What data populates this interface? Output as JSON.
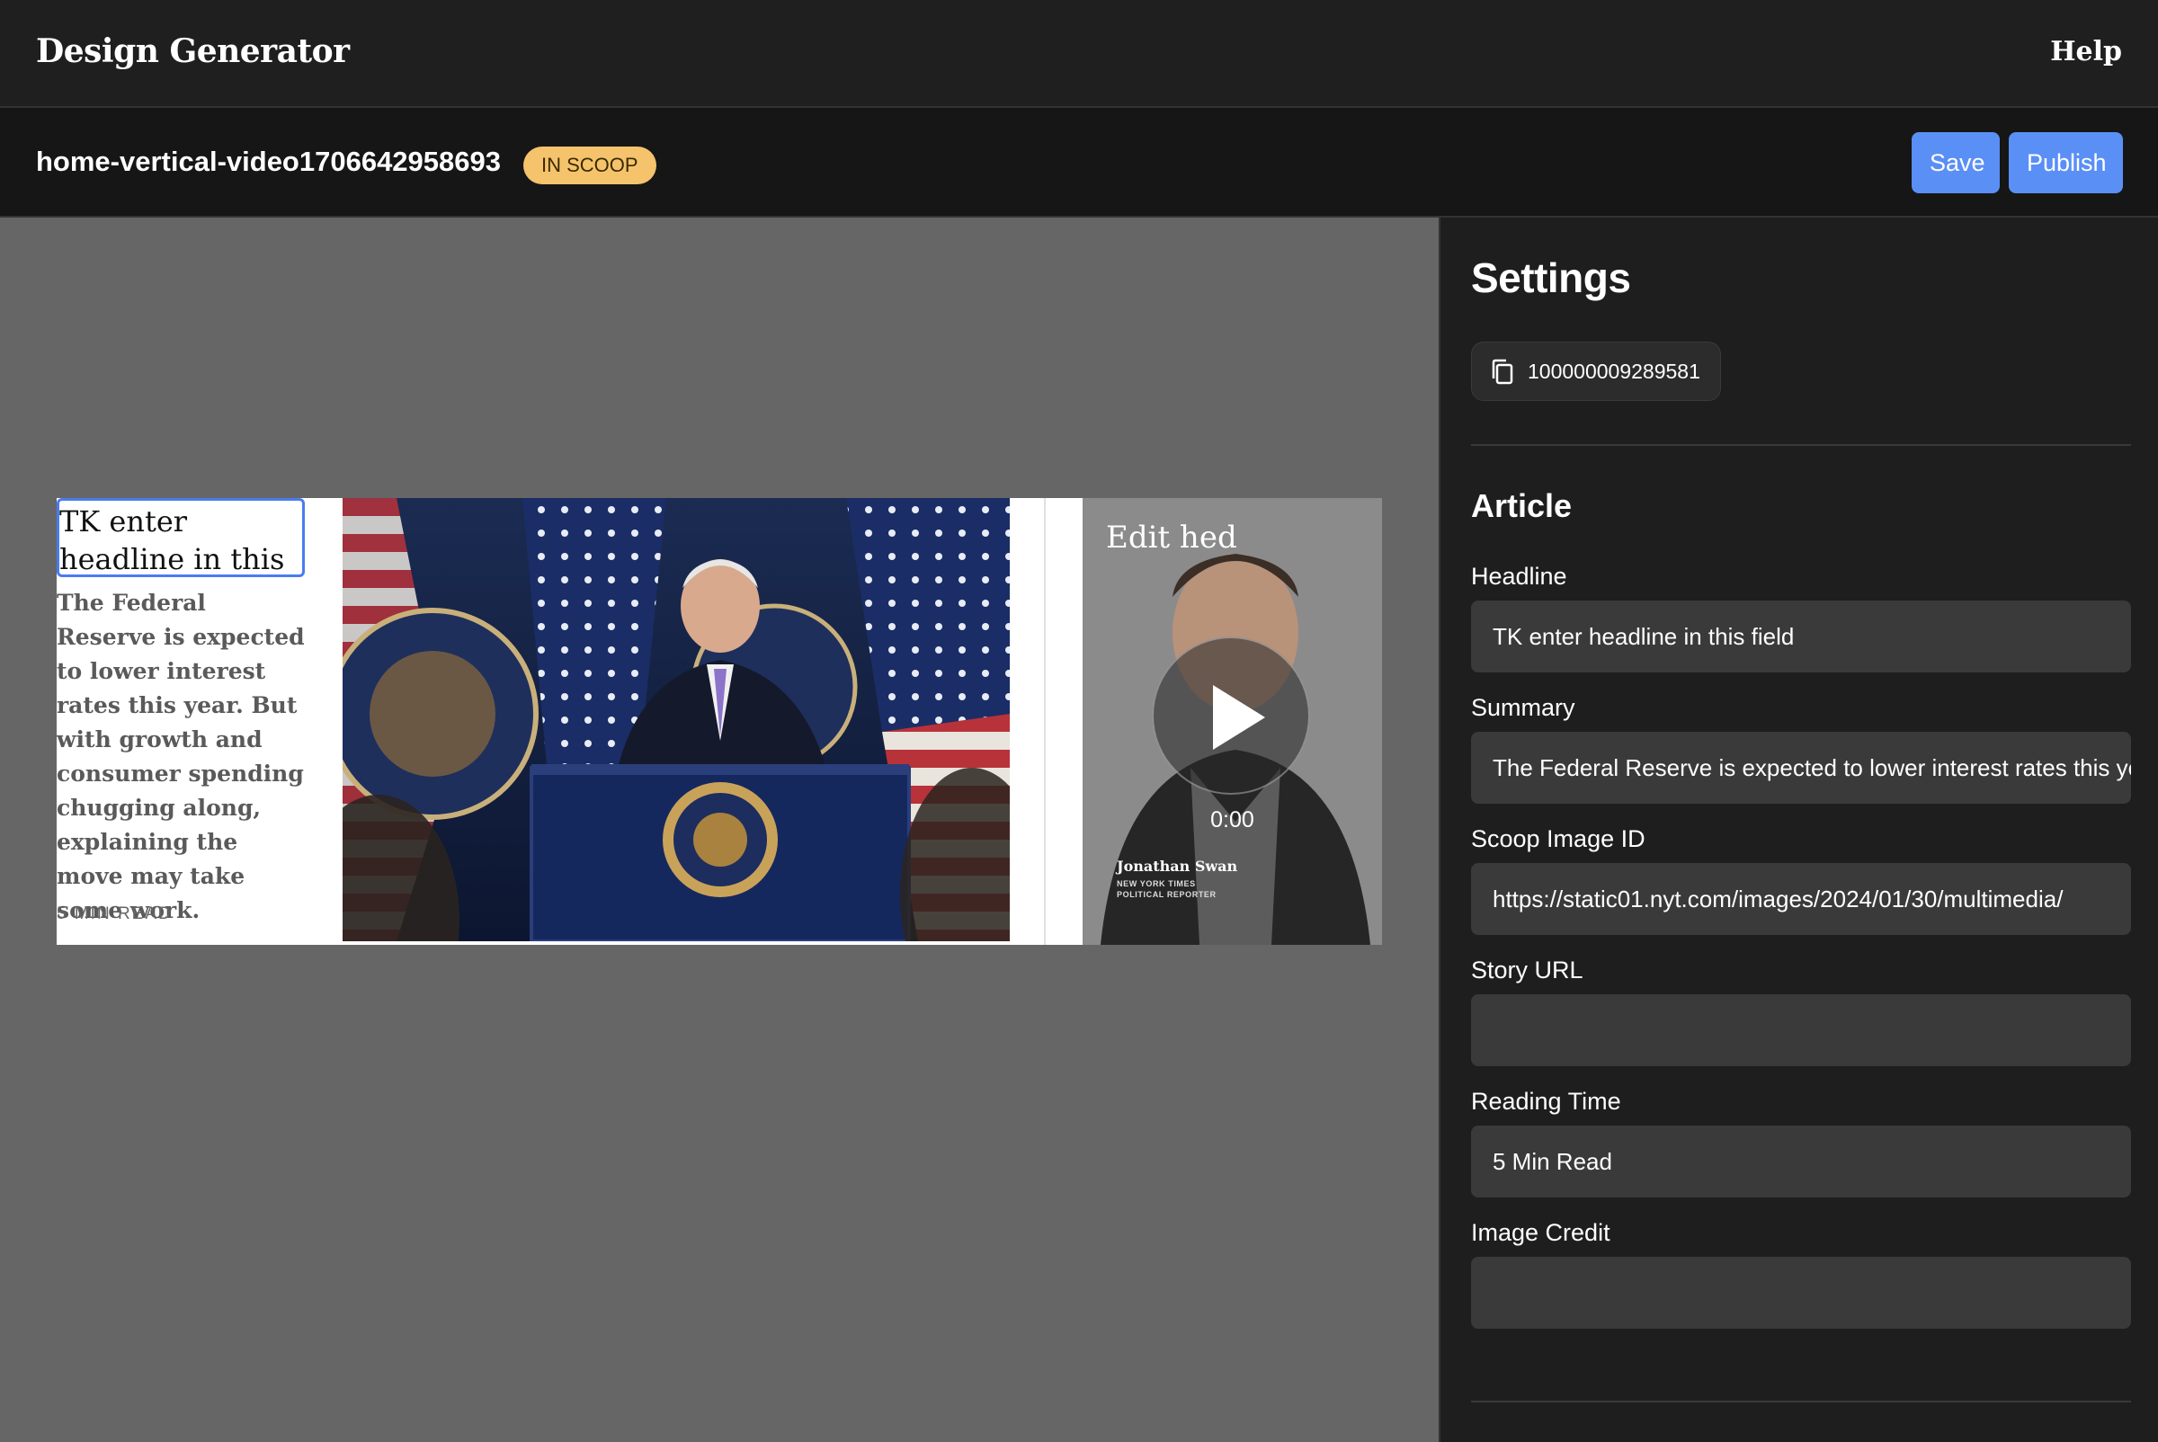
{
  "app": {
    "title": "Design Generator",
    "help_label": "Help"
  },
  "project": {
    "name": "home-vertical-video1706642958693",
    "status_badge": "IN SCOOP",
    "save_label": "Save",
    "publish_label": "Publish"
  },
  "preview": {
    "headline": "TK enter headline in this field",
    "summary": "The Federal Reserve is expected to lower interest rates this year. But with growth and consumer spending chugging along, explaining the move may take some work.",
    "reading_time": "5 MIN READ",
    "video": {
      "hed": "Edit hed",
      "time": "0:00",
      "presenter_name": "Jonathan Swan",
      "presenter_role": "NEW YORK TIMES POLITICAL REPORTER"
    }
  },
  "settings": {
    "title": "Settings",
    "asset_id": "100000009289581",
    "article_section_title": "Article",
    "fields": {
      "headline": {
        "label": "Headline",
        "value": "TK enter headline in this field"
      },
      "summary": {
        "label": "Summary",
        "value": "The Federal Reserve is expected to lower interest rates this year. But with growth and consumer spending chugging along, explaining the move may take some work."
      },
      "scoop_image_id": {
        "label": "Scoop Image ID",
        "value": "https://static01.nyt.com/images/2024/01/30/multimedia/"
      },
      "story_url": {
        "label": "Story URL",
        "value": ""
      },
      "reading_time": {
        "label": "Reading Time",
        "value": "5 Min Read"
      },
      "image_credit": {
        "label": "Image Credit",
        "value": ""
      }
    }
  },
  "colors": {
    "accent": "#5a8ff5",
    "badge": "#f5c36c",
    "background": "#1e1e1e",
    "canvas": "#666666"
  }
}
